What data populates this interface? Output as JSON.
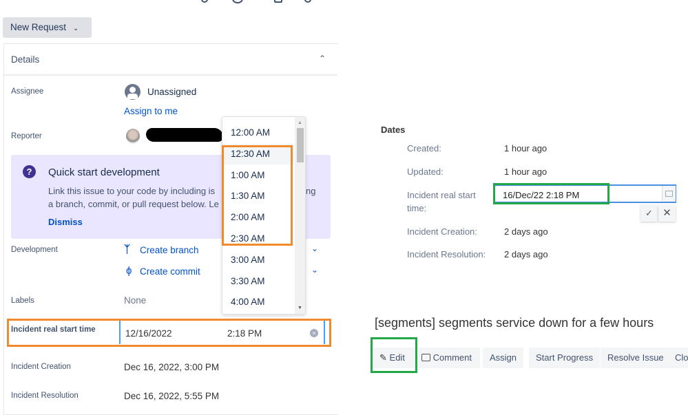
{
  "toolbar": {
    "new_request": "New Request"
  },
  "details": {
    "title": "Details",
    "assignee": {
      "label": "Assignee",
      "value": "Unassigned",
      "assign_link": "Assign to me"
    },
    "reporter": {
      "label": "Reporter"
    },
    "quick_start": {
      "title": "Quick start development",
      "line1a": "Link this issue to your code by including is",
      "line1b": "ng",
      "line2": "a branch, commit, or pull request below. Le",
      "dismiss": "Dismiss"
    },
    "development": {
      "label": "Development",
      "create_branch": "Create branch",
      "create_commit": "Create commit"
    },
    "labels": {
      "label": "Labels",
      "value": "None"
    },
    "incident_start": {
      "label": "Incident real start time",
      "date": "12/16/2022",
      "time": "2:18 PM"
    },
    "incident_creation": {
      "label": "Incident Creation",
      "value": "Dec 16, 2022, 3:00 PM"
    },
    "incident_resolution": {
      "label": "Incident Resolution",
      "value": "Dec 16, 2022, 5:55 PM"
    }
  },
  "time_dropdown": {
    "options": [
      "12:00 AM",
      "12:30 AM",
      "1:00 AM",
      "1:30 AM",
      "2:00 AM",
      "2:30 AM",
      "3:00 AM",
      "3:30 AM",
      "4:00 AM"
    ],
    "highlighted": "12:30 AM"
  },
  "dates": {
    "title": "Dates",
    "created": {
      "label": "Created:",
      "value": "1 hour ago"
    },
    "updated": {
      "label": "Updated:",
      "value": "1 hour ago"
    },
    "incident_start": {
      "label1": "Incident real start",
      "label2": "time:",
      "value": "16/Dec/22 2:18 PM"
    },
    "incident_creation": {
      "label": "Incident Creation:",
      "value": "2 days ago"
    },
    "incident_resolution": {
      "label": "Incident Resolution:",
      "value": "2 days ago"
    }
  },
  "issue": {
    "title": "[segments] segments service down for a few hours"
  },
  "actions": {
    "edit": "Edit",
    "comment": "Comment",
    "assign": "Assign",
    "start_progress": "Start Progress",
    "resolve": "Resolve Issue",
    "close": "Clo"
  },
  "colors": {
    "highlight_orange": "#f08a2c",
    "highlight_green": "#22a849",
    "link": "#0052cc",
    "purple": "#403294"
  }
}
